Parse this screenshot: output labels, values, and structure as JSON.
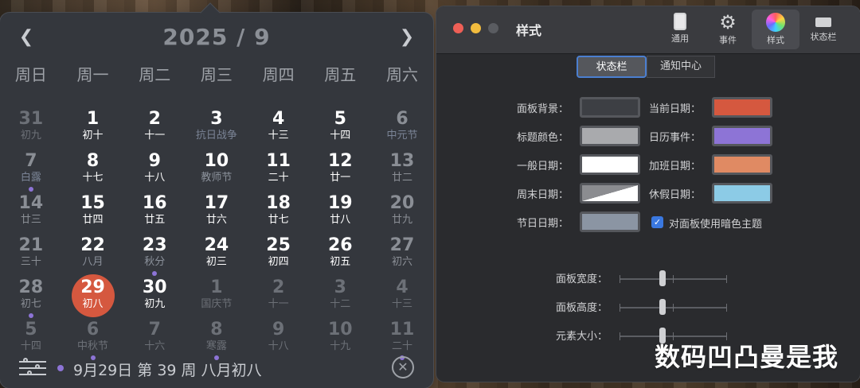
{
  "calendar": {
    "title": "2025 / 9",
    "prev": "❮",
    "next": "❯",
    "weekdays": [
      "周日",
      "周一",
      "周二",
      "周三",
      "周四",
      "周五",
      "周六"
    ],
    "weeks": [
      [
        {
          "n": "31",
          "l": "初九",
          "t": "muted"
        },
        {
          "n": "1",
          "l": "初十",
          "t": ""
        },
        {
          "n": "2",
          "l": "十一",
          "t": ""
        },
        {
          "n": "3",
          "l": "抗日战争",
          "t": "holiday"
        },
        {
          "n": "4",
          "l": "十三",
          "t": ""
        },
        {
          "n": "5",
          "l": "十四",
          "t": ""
        },
        {
          "n": "6",
          "l": "中元节",
          "t": "weekend holiday"
        }
      ],
      [
        {
          "n": "7",
          "l": "白露",
          "t": "weekend holiday",
          "dot": true
        },
        {
          "n": "8",
          "l": "十七",
          "t": ""
        },
        {
          "n": "9",
          "l": "十八",
          "t": ""
        },
        {
          "n": "10",
          "l": "教师节",
          "t": "festival"
        },
        {
          "n": "11",
          "l": "二十",
          "t": ""
        },
        {
          "n": "12",
          "l": "廿一",
          "t": ""
        },
        {
          "n": "13",
          "l": "廿二",
          "t": "weekend"
        }
      ],
      [
        {
          "n": "14",
          "l": "廿三",
          "t": "weekend"
        },
        {
          "n": "15",
          "l": "廿四",
          "t": ""
        },
        {
          "n": "16",
          "l": "廿五",
          "t": ""
        },
        {
          "n": "17",
          "l": "廿六",
          "t": ""
        },
        {
          "n": "18",
          "l": "廿七",
          "t": ""
        },
        {
          "n": "19",
          "l": "廿八",
          "t": ""
        },
        {
          "n": "20",
          "l": "廿九",
          "t": "weekend"
        }
      ],
      [
        {
          "n": "21",
          "l": "三十",
          "t": "weekend"
        },
        {
          "n": "22",
          "l": "八月",
          "t": "festival"
        },
        {
          "n": "23",
          "l": "秋分",
          "t": "festival",
          "dot": true
        },
        {
          "n": "24",
          "l": "初三",
          "t": ""
        },
        {
          "n": "25",
          "l": "初四",
          "t": ""
        },
        {
          "n": "26",
          "l": "初五",
          "t": ""
        },
        {
          "n": "27",
          "l": "初六",
          "t": "weekend"
        }
      ],
      [
        {
          "n": "28",
          "l": "初七",
          "t": "weekend",
          "dot": true
        },
        {
          "n": "29",
          "l": "初八",
          "t": "today"
        },
        {
          "n": "30",
          "l": "初九",
          "t": ""
        },
        {
          "n": "1",
          "l": "国庆节",
          "t": "muted"
        },
        {
          "n": "2",
          "l": "十一",
          "t": "muted"
        },
        {
          "n": "3",
          "l": "十二",
          "t": "muted"
        },
        {
          "n": "4",
          "l": "十三",
          "t": "muted"
        }
      ],
      [
        {
          "n": "5",
          "l": "十四",
          "t": "muted"
        },
        {
          "n": "6",
          "l": "中秋节",
          "t": "muted",
          "dot": true
        },
        {
          "n": "7",
          "l": "十六",
          "t": "muted"
        },
        {
          "n": "8",
          "l": "寒露",
          "t": "muted",
          "dot": true
        },
        {
          "n": "9",
          "l": "十八",
          "t": "muted"
        },
        {
          "n": "10",
          "l": "十九",
          "t": "muted"
        },
        {
          "n": "11",
          "l": "二十",
          "t": "muted",
          "dot": true
        }
      ]
    ],
    "footer": "9月29日 第 39 周 八月初八",
    "close": "✕"
  },
  "prefs": {
    "title": "样式",
    "tabs": [
      {
        "label": "通用",
        "icon": "general-icon"
      },
      {
        "label": "事件",
        "icon": "gear-icon"
      },
      {
        "label": "样式",
        "icon": "color-wheel-icon",
        "active": true
      },
      {
        "label": "状态栏",
        "icon": "menubar-icon"
      }
    ],
    "segments": [
      "状态栏",
      "通知中心"
    ],
    "left_rows": [
      {
        "label": "面板背景：",
        "color": "#3d3f44"
      },
      {
        "label": "标题颜色：",
        "color": "#a9aaad"
      },
      {
        "label": "一般日期：",
        "color": "#ffffff"
      },
      {
        "label": "周末日期：",
        "color": "split"
      },
      {
        "label": "节日日期：",
        "color": "#8b95a3"
      }
    ],
    "right_rows": [
      {
        "label": "当前日期：",
        "color": "#d5583f"
      },
      {
        "label": "日历事件：",
        "color": "#8d74d6"
      },
      {
        "label": "加班日期：",
        "color": "#e08a63"
      },
      {
        "label": "休假日期：",
        "color": "#8ccbe6"
      }
    ],
    "dark_theme_label": "对面板使用暗色主题",
    "dark_theme_checked": true,
    "sliders": [
      {
        "label": "面板宽度：",
        "value": 0.4
      },
      {
        "label": "面板高度：",
        "value": 0.4
      },
      {
        "label": "元素大小：",
        "value": 0.4
      }
    ]
  },
  "watermark": "数码凹凸曼是我",
  "colors": {
    "today": "#d5583f",
    "event": "#8d74d6",
    "accent": "#3a78e0"
  }
}
